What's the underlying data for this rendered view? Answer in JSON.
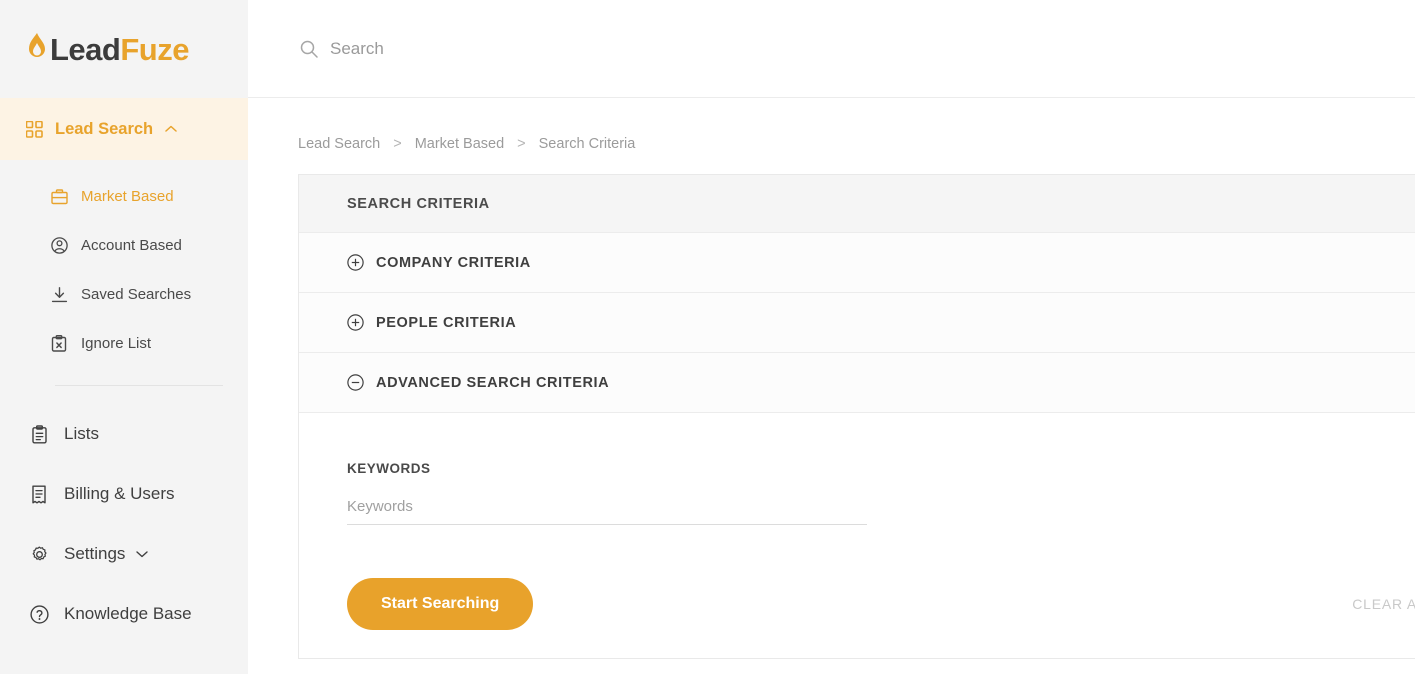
{
  "brand": {
    "name_part1": "Lead",
    "name_part2": "Fuze",
    "flame_icon": "flame-icon",
    "accent_color": "#e8a32c",
    "text_color": "#3c3c3c"
  },
  "sidebar": {
    "primary": {
      "label": "Lead Search",
      "icon": "grid-icon",
      "chevron": "chevron-up-icon",
      "active": true,
      "active_bg": "#fdf3e4"
    },
    "subitems": [
      {
        "label": "Market Based",
        "icon": "briefcase-icon",
        "active": true
      },
      {
        "label": "Account Based",
        "icon": "user-circle-icon",
        "active": false
      },
      {
        "label": "Saved Searches",
        "icon": "download-icon",
        "active": false
      },
      {
        "label": "Ignore List",
        "icon": "clipboard-x-icon",
        "active": false
      }
    ],
    "items": [
      {
        "label": "Lists",
        "icon": "clipboard-icon",
        "chevron": ""
      },
      {
        "label": "Billing & Users",
        "icon": "receipt-icon",
        "chevron": ""
      },
      {
        "label": "Settings",
        "icon": "gear-icon",
        "chevron": "chevron-down-icon"
      },
      {
        "label": "Knowledge Base",
        "icon": "question-circle-icon",
        "chevron": ""
      }
    ]
  },
  "topbar": {
    "search": {
      "placeholder": "Search",
      "value": "",
      "icon": "search-icon"
    }
  },
  "breadcrumb": {
    "items": [
      "Lead Search",
      "Market Based",
      "Search Criteria"
    ],
    "separator": ">"
  },
  "panel": {
    "header": "SEARCH CRITERIA",
    "sections": [
      {
        "label": "COMPANY CRITERIA",
        "icon": "plus-circle-icon",
        "expanded": false
      },
      {
        "label": "PEOPLE CRITERIA",
        "icon": "plus-circle-icon",
        "expanded": false
      },
      {
        "label": "ADVANCED SEARCH CRITERIA",
        "icon": "minus-circle-icon",
        "expanded": true
      }
    ],
    "advanced_body": {
      "keywords_label": "KEYWORDS",
      "keywords_placeholder": "Keywords",
      "keywords_value": ""
    },
    "start_button": "Start Searching",
    "clear_all": "CLEAR A"
  }
}
